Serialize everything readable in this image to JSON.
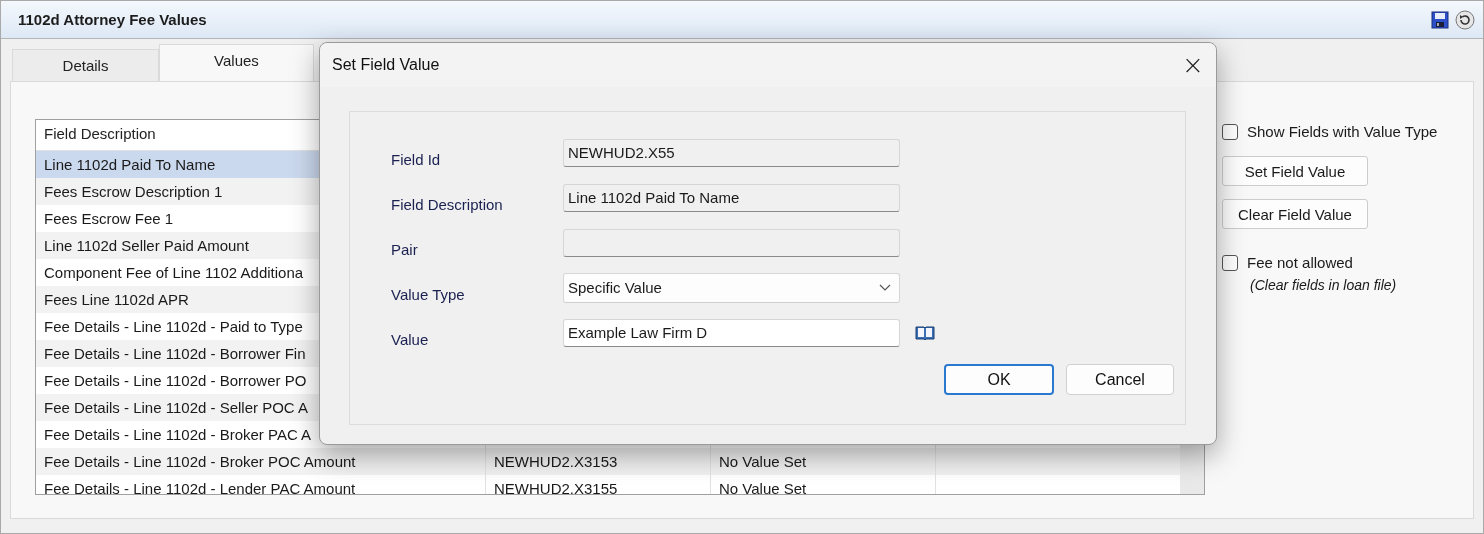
{
  "window": {
    "title": "1102d Attorney Fee Values"
  },
  "tabs": [
    {
      "label": "Details",
      "selected": false
    },
    {
      "label": "Values",
      "selected": true
    }
  ],
  "table": {
    "columns": [
      "Field Description"
    ],
    "rows": [
      {
        "cells": [
          "Line 1102d Paid To Name"
        ],
        "selected": true
      },
      {
        "cells": [
          "Fees Escrow Description 1"
        ],
        "selected": false
      },
      {
        "cells": [
          "Fees Escrow Fee 1"
        ],
        "selected": false
      },
      {
        "cells": [
          "Line 1102d Seller Paid Amount"
        ],
        "selected": false
      },
      {
        "cells": [
          "Component Fee of Line 1102 Additiona"
        ],
        "selected": false
      },
      {
        "cells": [
          "Fees Line 1102d APR"
        ],
        "selected": false
      },
      {
        "cells": [
          "Fee Details - Line 1102d - Paid to Type"
        ],
        "selected": false
      },
      {
        "cells": [
          "Fee Details - Line 1102d - Borrower Fin"
        ],
        "selected": false
      },
      {
        "cells": [
          "Fee Details - Line 1102d - Borrower PO"
        ],
        "selected": false
      },
      {
        "cells": [
          "Fee Details - Line 1102d - Seller POC A"
        ],
        "selected": false
      },
      {
        "cells": [
          "Fee Details - Line 1102d - Broker PAC A"
        ],
        "selected": false
      },
      {
        "cells": [
          "Fee Details - Line 1102d - Broker POC Amount",
          "NEWHUD2.X3153",
          "No Value Set"
        ],
        "selected": false
      },
      {
        "cells": [
          "Fee Details - Line 1102d - Lender PAC Amount",
          "NEWHUD2.X3155",
          "No Value Set"
        ],
        "selected": false
      }
    ]
  },
  "side_panel": {
    "show_fields_checkbox": {
      "label": "Show Fields with Value Type",
      "checked": false
    },
    "buttons": [
      "Set Field Value",
      "Clear Field Value"
    ],
    "fee_not_allowed_checkbox": {
      "label": "Fee not allowed",
      "checked": false,
      "note": "(Clear fields in loan file)"
    }
  },
  "dialog": {
    "title": "Set Field Value",
    "close": "×",
    "fields": [
      {
        "label": "Field Id",
        "kind": "readonly",
        "value": "NEWHUD2.X55"
      },
      {
        "label": "Field Description",
        "kind": "readonly",
        "value": "Line 1102d Paid To Name"
      },
      {
        "label": "Pair",
        "kind": "readonly"
      },
      {
        "label": "Value Type",
        "kind": "dropdown",
        "value": "Specific Value"
      },
      {
        "label": "Value",
        "kind": "lookup",
        "value": "Example Law Firm D"
      }
    ],
    "buttons": [
      {
        "label": "OK",
        "default": true
      },
      {
        "label": "Cancel",
        "default": false
      }
    ]
  }
}
